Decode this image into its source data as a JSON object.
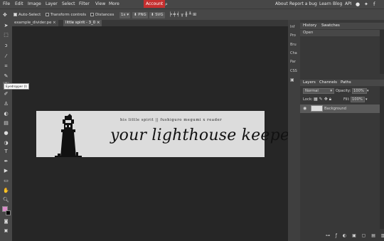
{
  "menu": {
    "items": [
      "File",
      "Edit",
      "Image",
      "Layer",
      "Select",
      "Filter",
      "View",
      "More"
    ],
    "account": "Account",
    "right": [
      "About",
      "Report a bug",
      "Learn",
      "Blog",
      "API"
    ]
  },
  "options": {
    "auto_select": "Auto-Select",
    "transform_controls": "Transform controls",
    "distances": "Distances",
    "zoom": "1x",
    "png": "PNG",
    "svg": "SVG"
  },
  "tabs": [
    "example_divider.pe",
    "little spirit - 3_0"
  ],
  "tooltip": "Eyedropper (I)",
  "document": {
    "subtitle": "his little spirit || fushiguro megumi x reader",
    "title": "your lighthouse keeper"
  },
  "dock": [
    "Inf",
    "Pro",
    "Bru",
    "Cha",
    "Par",
    "CSS"
  ],
  "history": {
    "tabs": [
      "History",
      "Swatches"
    ],
    "items": [
      "Open"
    ]
  },
  "layers": {
    "tabs": [
      "Layers",
      "Channels",
      "Paths"
    ],
    "blend": "Normal",
    "opacity_label": "Opacity:",
    "opacity": "100%",
    "lock_label": "Lock:",
    "fill_label": "Fill:",
    "fill": "100%",
    "layer_name": "Background"
  },
  "colors": {
    "foreground": "#d98cc8",
    "background": "#000000",
    "accent": "#c52f2f"
  }
}
